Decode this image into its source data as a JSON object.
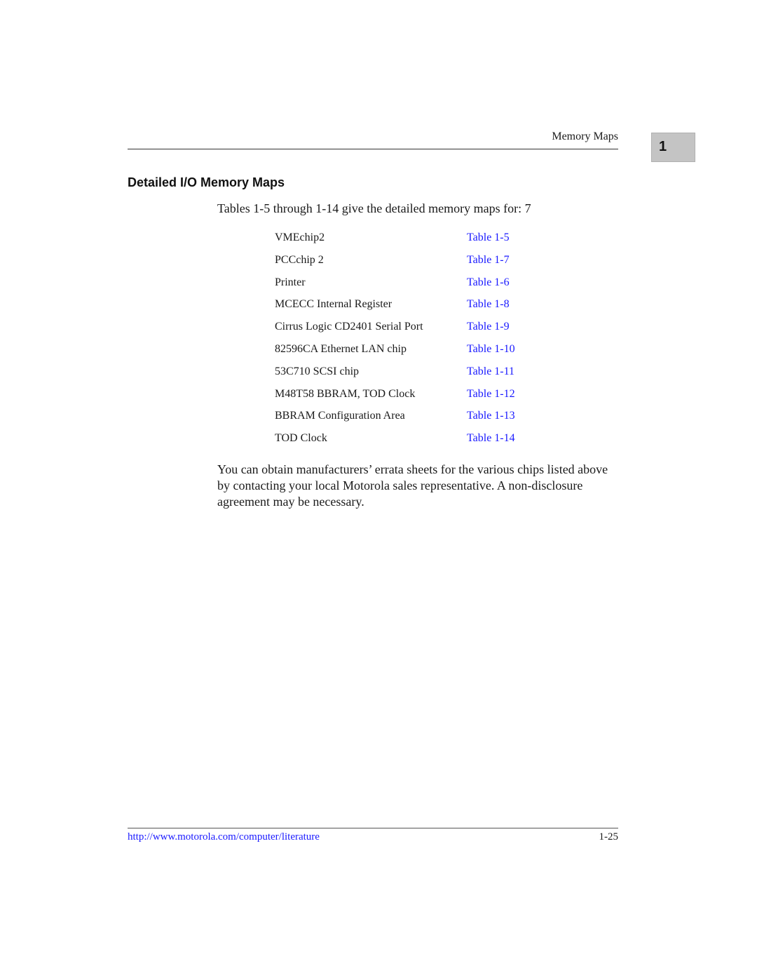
{
  "header": {
    "running_head": "Memory Maps",
    "chapter_tab": "1"
  },
  "section": {
    "title": "Detailed I/O Memory Maps",
    "intro": "Tables 1-5 through 1-14 give the detailed memory maps for: 7"
  },
  "map_list": [
    {
      "name": "VMEchip2",
      "ref": "Table 1-5"
    },
    {
      "name": "PCCchip 2",
      "ref": "Table 1-7"
    },
    {
      "name": "Printer",
      "ref": "Table 1-6"
    },
    {
      "name": "MCECC Internal Register",
      "ref": "Table 1-8"
    },
    {
      "name": "Cirrus Logic CD2401 Serial Port",
      "ref": "Table 1-9"
    },
    {
      "name": "82596CA Ethernet LAN chip",
      "ref": "Table 1-10"
    },
    {
      "name": "53C710 SCSI chip",
      "ref": "Table 1-11"
    },
    {
      "name": "M48T58 BBRAM, TOD Clock",
      "ref": "Table 1-12"
    },
    {
      "name": "BBRAM Configuration Area",
      "ref": "Table 1-13"
    },
    {
      "name": "TOD Clock",
      "ref": "Table 1-14"
    }
  ],
  "body_paragraph": "You can obtain manufacturers’ errata sheets for the various chips listed above by contacting your local Motorola sales representative. A non-disclosure agreement may be necessary.",
  "footer": {
    "url": "http://www.motorola.com/computer/literature",
    "page_number": "1-25"
  },
  "colors": {
    "link": "#1a1aff",
    "tab_background": "#c4c4c4"
  }
}
